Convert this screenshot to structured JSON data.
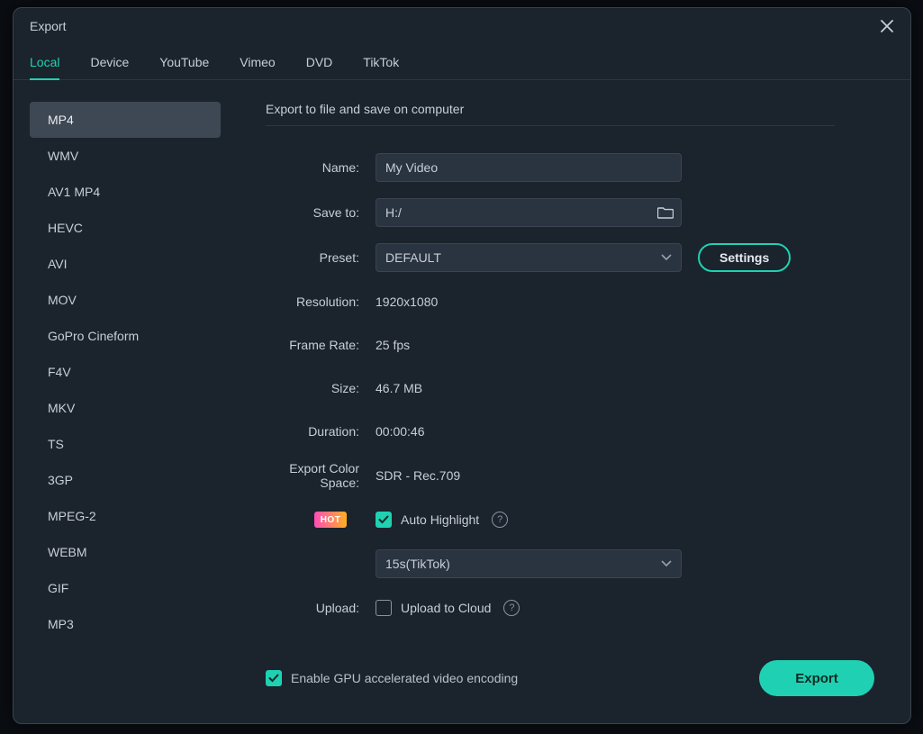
{
  "dialog": {
    "title": "Export"
  },
  "tabs": [
    "Local",
    "Device",
    "YouTube",
    "Vimeo",
    "DVD",
    "TikTok"
  ],
  "active_tab": 0,
  "formats": [
    "MP4",
    "WMV",
    "AV1 MP4",
    "HEVC",
    "AVI",
    "MOV",
    "GoPro Cineform",
    "F4V",
    "MKV",
    "TS",
    "3GP",
    "MPEG-2",
    "WEBM",
    "GIF",
    "MP3"
  ],
  "selected_format": 0,
  "section_header": "Export to file and save on computer",
  "labels": {
    "name": "Name:",
    "save_to": "Save to:",
    "preset": "Preset:",
    "resolution": "Resolution:",
    "frame_rate": "Frame Rate:",
    "size": "Size:",
    "duration": "Duration:",
    "color_space": "Export Color Space:",
    "upload": "Upload:"
  },
  "fields": {
    "name": "My Video",
    "save_to": "H:/",
    "preset": "DEFAULT",
    "resolution": "1920x1080",
    "frame_rate": "25 fps",
    "size": "46.7 MB",
    "duration": "00:00:46",
    "color_space": "SDR - Rec.709",
    "highlight_preset": "15s(TikTok)"
  },
  "auto_highlight": {
    "badge": "HOT",
    "label": "Auto Highlight",
    "checked": true
  },
  "upload_cloud": {
    "label": "Upload to Cloud",
    "checked": false
  },
  "gpu": {
    "label": "Enable GPU accelerated video encoding",
    "checked": true
  },
  "buttons": {
    "settings": "Settings",
    "export": "Export"
  }
}
